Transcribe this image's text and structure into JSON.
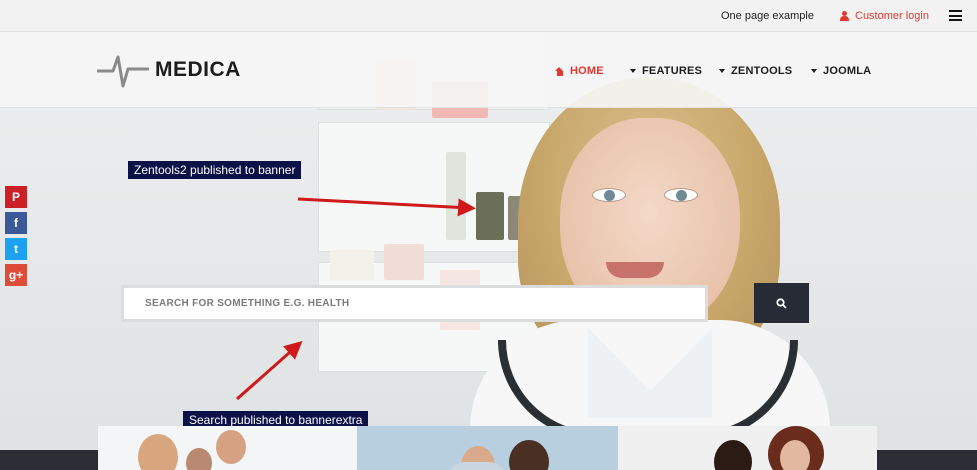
{
  "topbar": {
    "one_page_link": "One page example",
    "customer_login": "Customer login"
  },
  "header": {
    "logo_text": "MEDICA"
  },
  "nav": {
    "items": [
      {
        "label": "HOME",
        "active": true,
        "icon": "home-icon"
      },
      {
        "label": "FEATURES",
        "active": false,
        "icon": "caret-down-icon"
      },
      {
        "label": "ZENTOOLS",
        "active": false,
        "icon": "caret-down-icon"
      },
      {
        "label": "JOOMLA",
        "active": false,
        "icon": "caret-down-icon"
      }
    ]
  },
  "social": [
    {
      "name": "pinterest-icon",
      "glyph": "P",
      "color": "#cb2027"
    },
    {
      "name": "facebook-icon",
      "glyph": "f",
      "color": "#3b5998"
    },
    {
      "name": "twitter-icon",
      "glyph": "t",
      "color": "#1da1f2"
    },
    {
      "name": "google-plus-icon",
      "glyph": "g+",
      "color": "#dd4b39"
    }
  ],
  "annotations": {
    "banner_label": "Zentools2 published to banner",
    "bannerextra_label": "Search published to bannerextra"
  },
  "search": {
    "placeholder": "SEARCH FOR SOMETHING E.G. HEALTH"
  },
  "colors": {
    "accent": "#e03a2f",
    "annotation_bg": "#0c1147",
    "search_button": "#262b35",
    "arrow": "#d0191b"
  }
}
